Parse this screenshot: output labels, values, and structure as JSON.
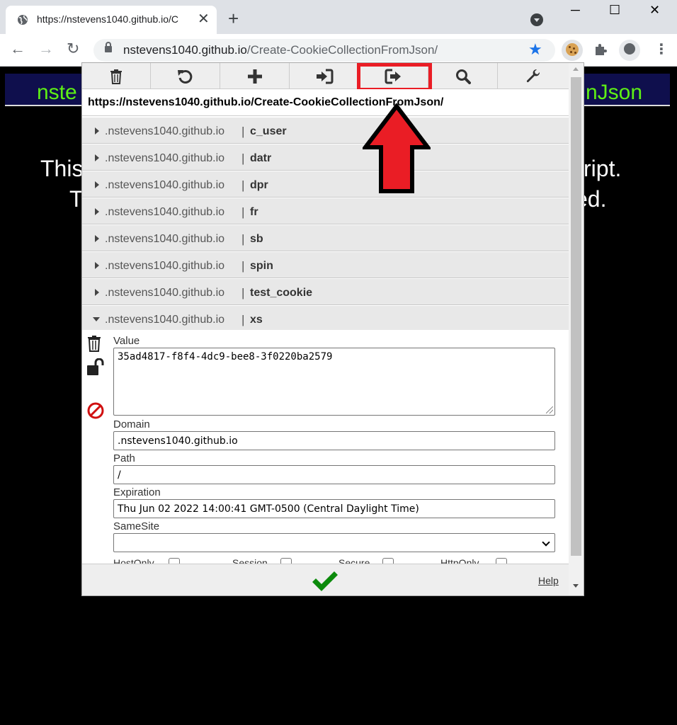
{
  "browser": {
    "tab_title": "https://nstevens1040.github.io/C",
    "tab_close": "✕",
    "new_tab": "+",
    "url_host": "nstevens1040.github.io",
    "url_path": "/Create-CookieCollectionFromJson/",
    "window_minimize": "─",
    "window_maximize": "☐",
    "window_close": "✕"
  },
  "page": {
    "header_left": "nste",
    "header_right": "nJson",
    "line1_left": "This",
    "line1_right": "cript.",
    "line2_left": "T",
    "line2_right": "ed."
  },
  "popup": {
    "toolbar_icons": [
      "trash-icon",
      "undo-icon",
      "plus-icon",
      "import-icon",
      "export-icon",
      "search-icon",
      "wrench-icon"
    ],
    "url": "https://nstevens1040.github.io/Create-CookieCollectionFromJson/",
    "separator": "|",
    "cookies": [
      {
        "domain": ".nstevens1040.github.io",
        "name": "c_user"
      },
      {
        "domain": ".nstevens1040.github.io",
        "name": "datr"
      },
      {
        "domain": ".nstevens1040.github.io",
        "name": "dpr"
      },
      {
        "domain": ".nstevens1040.github.io",
        "name": "fr"
      },
      {
        "domain": ".nstevens1040.github.io",
        "name": "sb"
      },
      {
        "domain": ".nstevens1040.github.io",
        "name": "spin"
      },
      {
        "domain": ".nstevens1040.github.io",
        "name": "test_cookie"
      },
      {
        "domain": ".nstevens1040.github.io",
        "name": "xs"
      }
    ],
    "detail": {
      "value_label": "Value",
      "value": "35ad4817-f8f4-4dc9-bee8-3f0220ba2579",
      "domain_label": "Domain",
      "domain": ".nstevens1040.github.io",
      "path_label": "Path",
      "path": "/",
      "expiration_label": "Expiration",
      "expiration": "Thu Jun 02 2022 14:00:41 GMT-0500 (Central Daylight Time)",
      "samesite_label": "SameSite",
      "samesite": "",
      "flags": [
        "HostOnly",
        "Session",
        "Secure",
        "HttpOnly"
      ],
      "flag_secure_checked": true
    },
    "help_label": "Help"
  },
  "colors": {
    "highlight": "#ea1d25",
    "page_header_text": "#5ef015",
    "checkmark": "#0b8a0b",
    "block_icon": "#d01010"
  }
}
